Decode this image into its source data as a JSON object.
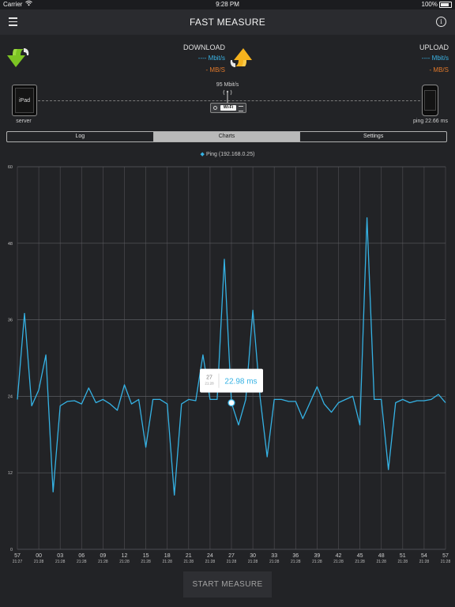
{
  "status_bar": {
    "carrier": "Carrier",
    "time": "9:28 PM",
    "battery": "100%"
  },
  "navbar": {
    "title": "FAST MEASURE",
    "info_glyph": "i"
  },
  "download": {
    "label": "DOWNLOAD",
    "mbit": "---- Mbit/s",
    "mbs": "- MB/S"
  },
  "upload": {
    "label": "UPLOAD",
    "mbit": "---- Mbit/s",
    "mbs": "- MB/S"
  },
  "devices": {
    "left_device": "iPad",
    "left_label": "server",
    "right_label": "ping 22.66 ms",
    "router_rate": "95 Mbit/s",
    "router_tag": "Wi-Fi"
  },
  "tabs": [
    {
      "label": "Log",
      "active": false
    },
    {
      "label": "Charts",
      "active": true
    },
    {
      "label": "Settings",
      "active": false
    }
  ],
  "colors": {
    "line": "#35b2e4",
    "download_value": "#3ab4e6",
    "mbs_value": "#e0782a",
    "background": "#222326"
  },
  "chart_data": {
    "type": "line",
    "series": [
      {
        "name": "Ping (192.168.0.25)",
        "values": [
          23.5,
          37,
          22.5,
          25,
          30.5,
          9,
          22.5,
          23.2,
          23.3,
          22.8,
          25.3,
          23,
          23.5,
          22.8,
          21.8,
          25.8,
          22.8,
          23.5,
          16,
          23.5,
          23.5,
          22.8,
          8.5,
          22.8,
          23.5,
          23.3,
          30.5,
          23.5,
          23.5,
          45.5,
          22.98,
          19.5,
          23.5,
          37.5,
          24,
          14.5,
          23.5,
          23.5,
          23.2,
          23.2,
          20.5,
          23,
          25.5,
          22.8,
          21.5,
          23,
          23.5,
          24,
          19.5,
          52,
          23.5,
          23.5,
          12.5,
          23,
          23.5,
          23,
          23.3,
          23.3,
          23.5,
          24.3,
          23
        ]
      }
    ],
    "x_tick_labels": [
      "57",
      "00",
      "03",
      "06",
      "09",
      "12",
      "15",
      "18",
      "21",
      "24",
      "27",
      "30",
      "33",
      "36",
      "39",
      "42",
      "45",
      "48",
      "51",
      "54",
      "57"
    ],
    "x_tick_sublabels": [
      "21:27",
      "21:28",
      "21:28",
      "21:28",
      "21:28",
      "21:28",
      "21:28",
      "21:28",
      "21:28",
      "21:28",
      "21:28",
      "21:28",
      "21:28",
      "21:28",
      "21:28",
      "21:28",
      "21:28",
      "21:28",
      "21:28",
      "21:28",
      "21:28"
    ],
    "ylim": [
      0,
      60
    ],
    "y_ticks": [
      0,
      12,
      24,
      36,
      48,
      60
    ],
    "grid": true,
    "legend": "top-center",
    "highlight": {
      "index": 30,
      "value": 22.98,
      "tooltip_tick": "27",
      "tooltip_time": "21:28",
      "tooltip_value": "22.98 ms"
    }
  },
  "start_button": {
    "label": "START MEASURE"
  }
}
